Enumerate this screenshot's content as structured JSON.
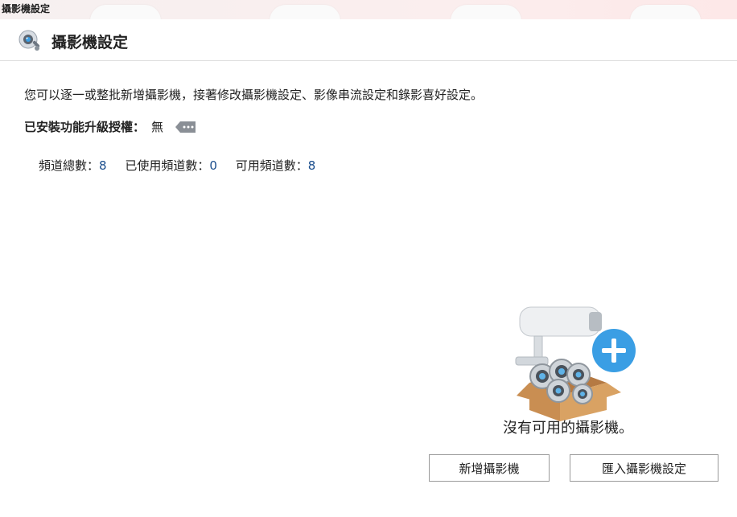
{
  "window": {
    "title": "攝影機設定"
  },
  "header": {
    "title": "攝影機設定",
    "icon": "camera-settings-icon"
  },
  "description": "您可以逐一或整批新增攝影機，接著修改攝影機設定、影像串流設定和錄影喜好設定。",
  "license": {
    "label": "已安裝功能升級授權：",
    "value": "無",
    "icon": "license-tag-icon"
  },
  "channels": {
    "total_label": "頻道總數：",
    "total": "8",
    "used_label": "已使用頻道數：",
    "used": "0",
    "available_label": "可用頻道數：",
    "available": "8"
  },
  "empty_state": {
    "message": "沒有可用的攝影機。",
    "icon": "cameras-box-add-icon"
  },
  "buttons": {
    "add_camera": "新增攝影機",
    "import_settings": "匯入攝影機設定"
  },
  "colors": {
    "accent_blue": "#3a9ee4",
    "number_blue": "#1a4d8c",
    "divider": "#dcdcdc"
  }
}
